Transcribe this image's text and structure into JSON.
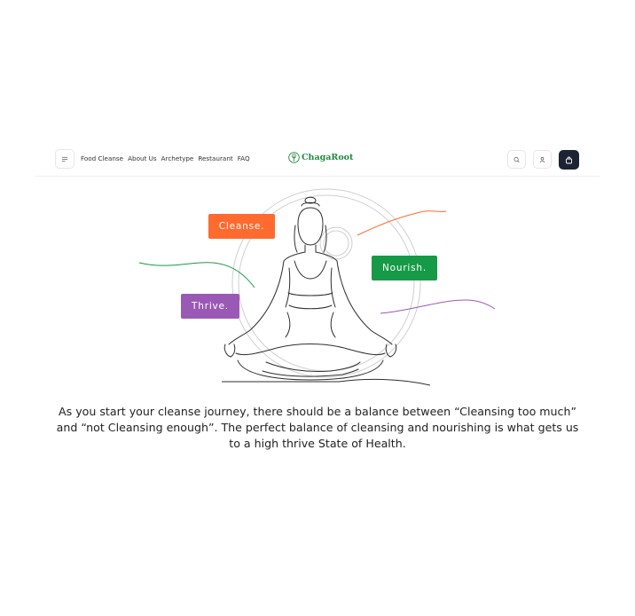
{
  "header": {
    "nav": [
      "Food Cleanse",
      "About Us",
      "Archetype",
      "Restaurant",
      "FAQ"
    ],
    "brand": "ChagaRoot",
    "icons": [
      "menu-icon",
      "search-icon",
      "user-icon",
      "cart-icon"
    ]
  },
  "hero": {
    "tags": {
      "cleanse": "Cleanse.",
      "nourish": "Nourish.",
      "thrive": "Thrive."
    },
    "colors": {
      "cleanse": "#ff6a2e",
      "nourish": "#169a47",
      "thrive": "#9b59b6"
    }
  },
  "description": "As you start your cleanse journey, there should be a balance between “Cleansing too much” and “not Cleansing enough”. The perfect balance of cleansing and nourishing is what gets us to a high thrive State of Health."
}
